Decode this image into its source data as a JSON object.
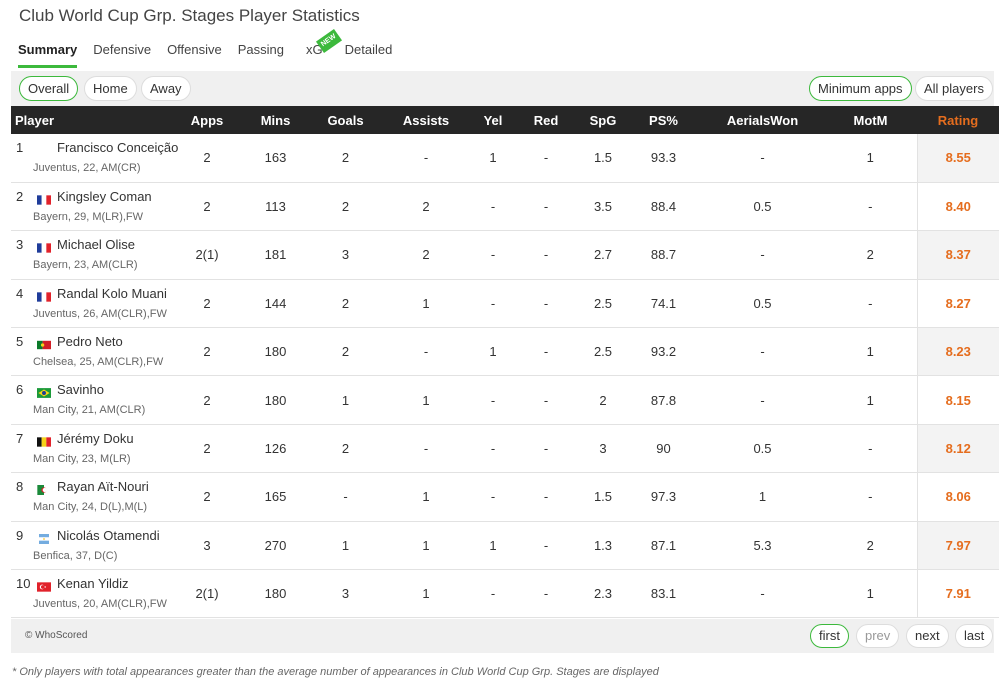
{
  "page_title": "Club World Cup Grp. Stages Player Statistics",
  "tabs": [
    "Summary",
    "Defensive",
    "Offensive",
    "Passing",
    "xG",
    "Detailed"
  ],
  "new_badge": "NEW",
  "filters": {
    "overall": "Overall",
    "home": "Home",
    "away": "Away",
    "min_apps": "Minimum apps",
    "all_players": "All players"
  },
  "columns": [
    "Player",
    "Apps",
    "Mins",
    "Goals",
    "Assists",
    "Yel",
    "Red",
    "SpG",
    "PS%",
    "AerialsWon",
    "MotM",
    "Rating"
  ],
  "rows": [
    {
      "rank": "1",
      "flag": "",
      "name": "Francisco Conceição",
      "meta": "Juventus,  22, AM(CR)",
      "apps": "2",
      "mins": "163",
      "goals": "2",
      "assists": "-",
      "yel": "1",
      "red": "-",
      "spg": "1.5",
      "ps": "93.3",
      "aerials": "-",
      "motm": "1",
      "rating": "8.55"
    },
    {
      "rank": "2",
      "flag": "france",
      "name": "Kingsley Coman",
      "meta": "Bayern,  29, M(LR),FW",
      "apps": "2",
      "mins": "113",
      "goals": "2",
      "assists": "2",
      "yel": "-",
      "red": "-",
      "spg": "3.5",
      "ps": "88.4",
      "aerials": "0.5",
      "motm": "-",
      "rating": "8.40"
    },
    {
      "rank": "3",
      "flag": "france",
      "name": "Michael Olise",
      "meta": "Bayern,  23, AM(CLR)",
      "apps": "2(1)",
      "mins": "181",
      "goals": "3",
      "assists": "2",
      "yel": "-",
      "red": "-",
      "spg": "2.7",
      "ps": "88.7",
      "aerials": "-",
      "motm": "2",
      "rating": "8.37"
    },
    {
      "rank": "4",
      "flag": "france",
      "name": "Randal Kolo Muani",
      "meta": "Juventus,  26, AM(CLR),FW",
      "apps": "2",
      "mins": "144",
      "goals": "2",
      "assists": "1",
      "yel": "-",
      "red": "-",
      "spg": "2.5",
      "ps": "74.1",
      "aerials": "0.5",
      "motm": "-",
      "rating": "8.27"
    },
    {
      "rank": "5",
      "flag": "portugal",
      "name": "Pedro Neto",
      "meta": "Chelsea,  25, AM(CLR),FW",
      "apps": "2",
      "mins": "180",
      "goals": "2",
      "assists": "-",
      "yel": "1",
      "red": "-",
      "spg": "2.5",
      "ps": "93.2",
      "aerials": "-",
      "motm": "1",
      "rating": "8.23"
    },
    {
      "rank": "6",
      "flag": "brazil",
      "name": "Savinho",
      "meta": "Man City,  21, AM(CLR)",
      "apps": "2",
      "mins": "180",
      "goals": "1",
      "assists": "1",
      "yel": "-",
      "red": "-",
      "spg": "2",
      "ps": "87.8",
      "aerials": "-",
      "motm": "1",
      "rating": "8.15"
    },
    {
      "rank": "7",
      "flag": "belgium",
      "name": "Jérémy Doku",
      "meta": "Man City,  23, M(LR)",
      "apps": "2",
      "mins": "126",
      "goals": "2",
      "assists": "-",
      "yel": "-",
      "red": "-",
      "spg": "3",
      "ps": "90",
      "aerials": "0.5",
      "motm": "-",
      "rating": "8.12"
    },
    {
      "rank": "8",
      "flag": "algeria",
      "name": "Rayan Aït-Nouri",
      "meta": "Man City,  24, D(L),M(L)",
      "apps": "2",
      "mins": "165",
      "goals": "-",
      "assists": "1",
      "yel": "-",
      "red": "-",
      "spg": "1.5",
      "ps": "97.3",
      "aerials": "1",
      "motm": "-",
      "rating": "8.06"
    },
    {
      "rank": "9",
      "flag": "argentina",
      "name": "Nicolás Otamendi",
      "meta": "Benfica,  37, D(C)",
      "apps": "3",
      "mins": "270",
      "goals": "1",
      "assists": "1",
      "yel": "1",
      "red": "-",
      "spg": "1.3",
      "ps": "87.1",
      "aerials": "5.3",
      "motm": "2",
      "rating": "7.97"
    },
    {
      "rank": "10",
      "flag": "turkey",
      "name": "Kenan Yildiz",
      "meta": "Juventus,  20, AM(CLR),FW",
      "apps": "2(1)",
      "mins": "180",
      "goals": "3",
      "assists": "1",
      "yel": "-",
      "red": "-",
      "spg": "2.3",
      "ps": "83.1",
      "aerials": "-",
      "motm": "1",
      "rating": "7.91"
    }
  ],
  "copyright": "© WhoScored",
  "pagination": [
    "first",
    "prev",
    "next",
    "last"
  ],
  "footnote": "* Only players with total appearances greater than the average number of appearances in Club World Cup Grp. Stages are displayed",
  "colors": {
    "accent_green": "#3cb93c",
    "rating_orange": "#e56d1e",
    "header_dark": "#262626"
  }
}
